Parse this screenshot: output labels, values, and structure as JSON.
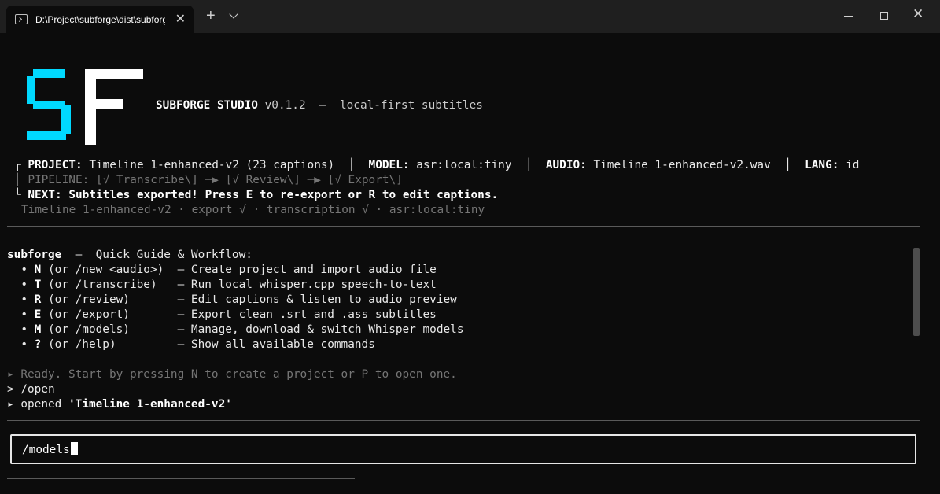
{
  "window": {
    "tab_title": "D:\\Project\\subforge\\dist\\subforge.exe",
    "tab_close": "✕",
    "new_tab": "+",
    "close": "✕"
  },
  "header": {
    "logo_text": "SF",
    "app_name": "SUBFORGE STUDIO",
    "version": "v0.1.2",
    "separator": "—",
    "tagline": "local-first subtitles"
  },
  "status": {
    "project_label": "PROJECT:",
    "project_value": "Timeline 1-enhanced-v2 (23 captions)",
    "model_label": "MODEL:",
    "model_value": "asr:local:tiny",
    "audio_label": "AUDIO:",
    "audio_value": "Timeline 1-enhanced-v2.wav",
    "lang_label": "LANG:",
    "lang_value": "id",
    "pipeline_label": "PIPELINE:",
    "pipeline_value": "[√ Transcribe\\] ─▶ [√ Review\\] ─▶ [√ Export\\]",
    "next_label": "NEXT:",
    "next_value": "Subtitles exported! Press E to re-export or R to edit captions.",
    "summary": "Timeline 1-enhanced-v2 · export √ · transcription √ · asr:local:tiny"
  },
  "guide": {
    "heading_name": "subforge",
    "heading_rest": "  —  Quick Guide & Workflow:",
    "items": [
      {
        "key": "N",
        "alias": " (or /new <audio>)  ",
        "desc": "— Create project and import audio file"
      },
      {
        "key": "T",
        "alias": " (or /transcribe)   ",
        "desc": "— Run local whisper.cpp speech-to-text"
      },
      {
        "key": "R",
        "alias": " (or /review)       ",
        "desc": "— Edit captions & listen to audio preview"
      },
      {
        "key": "E",
        "alias": " (or /export)       ",
        "desc": "— Export clean .srt and .ass subtitles"
      },
      {
        "key": "M",
        "alias": " (or /models)       ",
        "desc": "— Manage, download & switch Whisper models"
      },
      {
        "key": "?",
        "alias": " (or /help)         ",
        "desc": "— Show all available commands"
      }
    ]
  },
  "log": {
    "line1": "▸ Ready. Start by pressing N to create a project or P to open one.",
    "line2_prompt": "> ",
    "line2_cmd": "/open",
    "line3_prefix": "▸ opened ",
    "line3_value": "'Timeline 1-enhanced-v2'"
  },
  "input": {
    "value": "/models"
  }
}
